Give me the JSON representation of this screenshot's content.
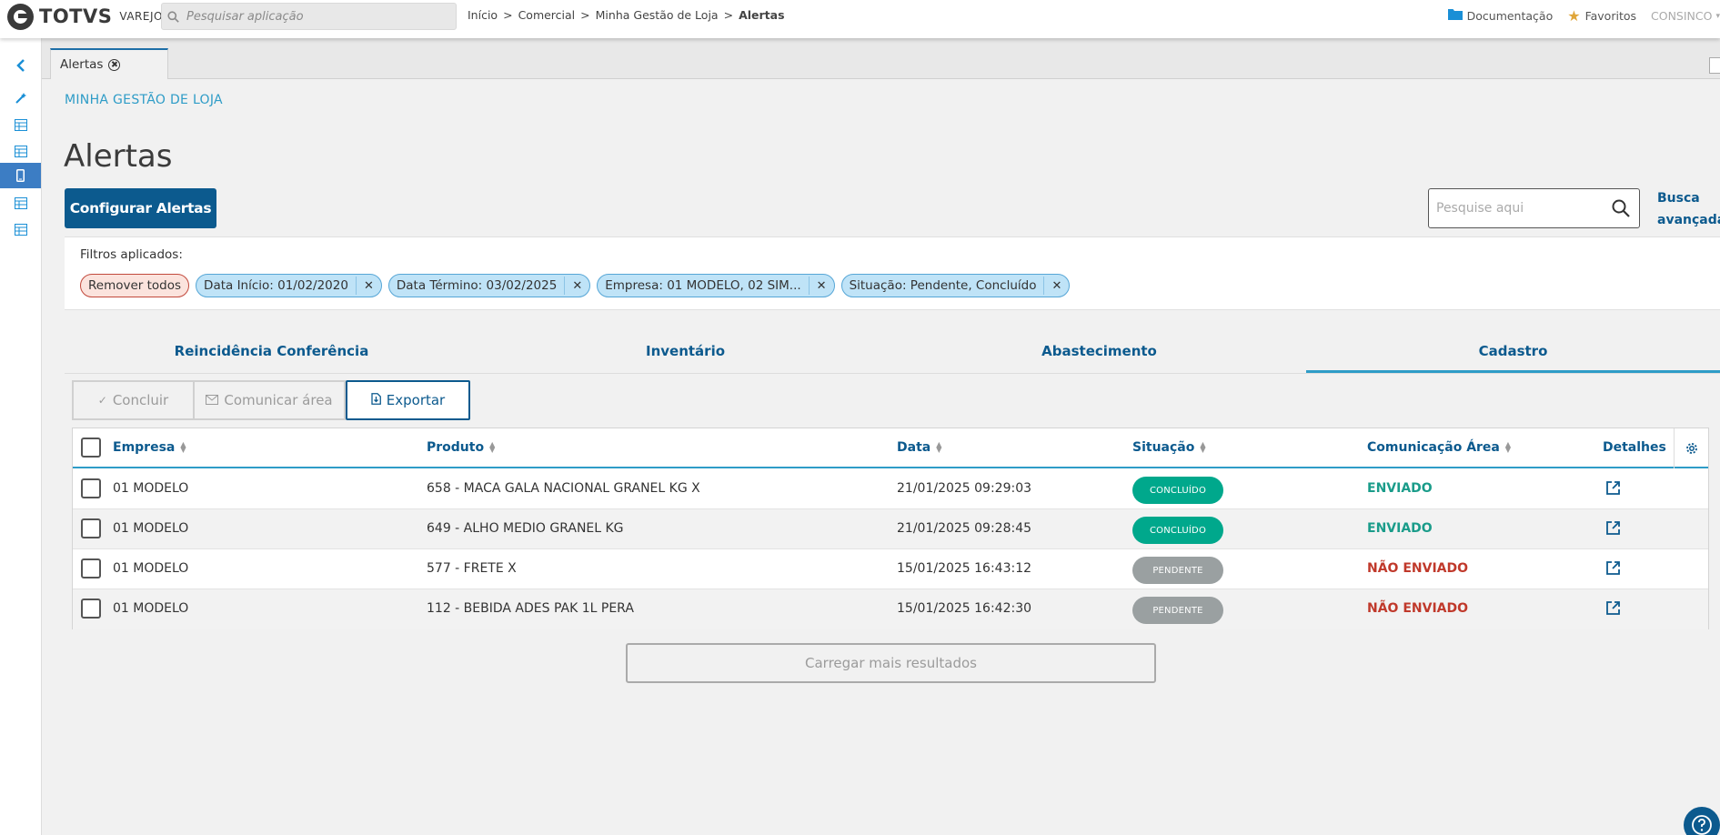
{
  "header": {
    "logo_text": "TOTVS",
    "logo_sub": "VAREJO",
    "search_placeholder": "Pesquisar aplicação",
    "breadcrumb": [
      "Início",
      ">",
      "Comercial",
      ">",
      "Minha Gestão de Loja",
      ">",
      "Alertas"
    ],
    "documentation_label": "Documentação",
    "favorites_label": "Favoritos",
    "user_label": "CONSINCO"
  },
  "tabstrip": {
    "tab_label": "Alertas"
  },
  "page": {
    "section_title": "MINHA GESTÃO DE LOJA",
    "title": "Alertas",
    "configure_button": "Configurar Alertas",
    "search_placeholder": "Pesquise aqui",
    "advanced_search_line1": "Busca",
    "advanced_search_line2": "avançada"
  },
  "filters": {
    "label": "Filtros aplicados:",
    "remove_all": "Remover todos",
    "chips": [
      "Data Início: 01/02/2020",
      "Data Término: 03/02/2025",
      "Empresa: 01 MODELO, 02 SIM...",
      "Situação: Pendente, Concluído"
    ]
  },
  "tabs": [
    "Reincidência Conferência",
    "Inventário",
    "Abastecimento",
    "Cadastro"
  ],
  "active_tab": "Cadastro",
  "actions": {
    "concluir": "Concluir",
    "comunicar": "Comunicar área",
    "exportar": "Exportar"
  },
  "table": {
    "headers": [
      "Empresa",
      "Produto",
      "Data",
      "Situação",
      "Comunicação Área",
      "Detalhes"
    ],
    "rows": [
      {
        "empresa": "01 MODELO",
        "produto": "658 - MACA GALA NACIONAL GRANEL KG X",
        "data": "21/01/2025 09:29:03",
        "situacao": "CONCLUÍDO",
        "comunicacao": "ENVIADO"
      },
      {
        "empresa": "01 MODELO",
        "produto": "649 - ALHO MEDIO GRANEL KG",
        "data": "21/01/2025 09:28:45",
        "situacao": "CONCLUÍDO",
        "comunicacao": "ENVIADO"
      },
      {
        "empresa": "01 MODELO",
        "produto": "577 - FRETE X",
        "data": "15/01/2025 16:43:12",
        "situacao": "PENDENTE",
        "comunicacao": "NÃO ENVIADO"
      },
      {
        "empresa": "01 MODELO",
        "produto": "112 - BEBIDA ADES PAK 1L PERA",
        "data": "15/01/2025 16:42:30",
        "situacao": "PENDENTE",
        "comunicacao": "NÃO ENVIADO"
      }
    ]
  },
  "load_more": "Carregar mais resultados",
  "colors": {
    "primary": "#0c5a8e",
    "accent": "#2e9cc7",
    "success": "#00a88c",
    "pending": "#9aa0a1",
    "danger": "#c0392b"
  }
}
